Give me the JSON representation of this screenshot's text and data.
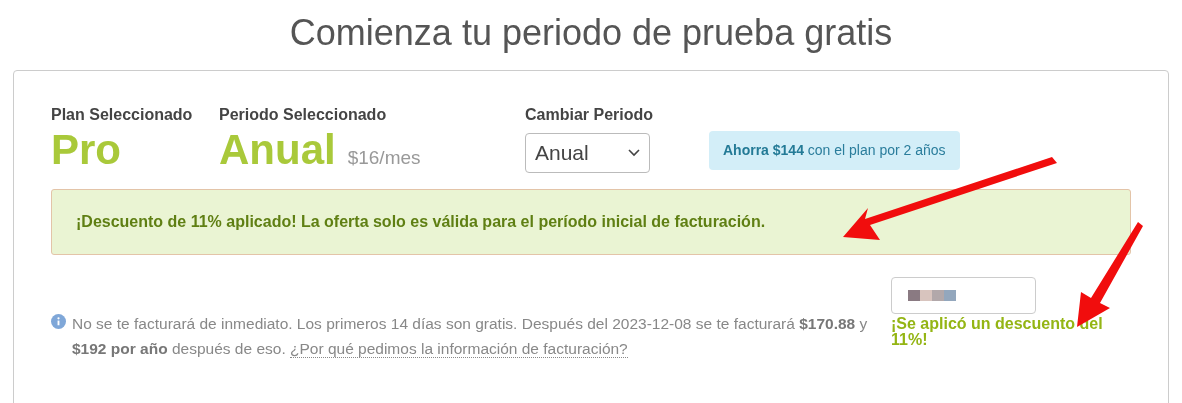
{
  "title": "Comienza tu periodo de prueba gratis",
  "plan": {
    "label": "Plan Seleccionado",
    "value": "Pro"
  },
  "period": {
    "label": "Periodo Seleccionado",
    "value": "Anual",
    "price": "$16/mes"
  },
  "change_period": {
    "label": "Cambiar Periodo",
    "value": "Anual"
  },
  "savings_badge": "**Ahorra $144** con el plan por 2 años",
  "discount_alert": "¡Descuento de 11% aplicado! La oferta solo es válida para el período inicial de facturación.",
  "billing_note": {
    "text": "No se te facturará de inmediato. Los primeros 14 días son gratis. Después del 2023-12-08 se te facturará **$170.88** y **$192 por año** después de eso.",
    "link": "¿Por qué pedimos la información de facturación?"
  },
  "coupon": {
    "message": "¡Se aplicó un descuento del 11%!"
  }
}
